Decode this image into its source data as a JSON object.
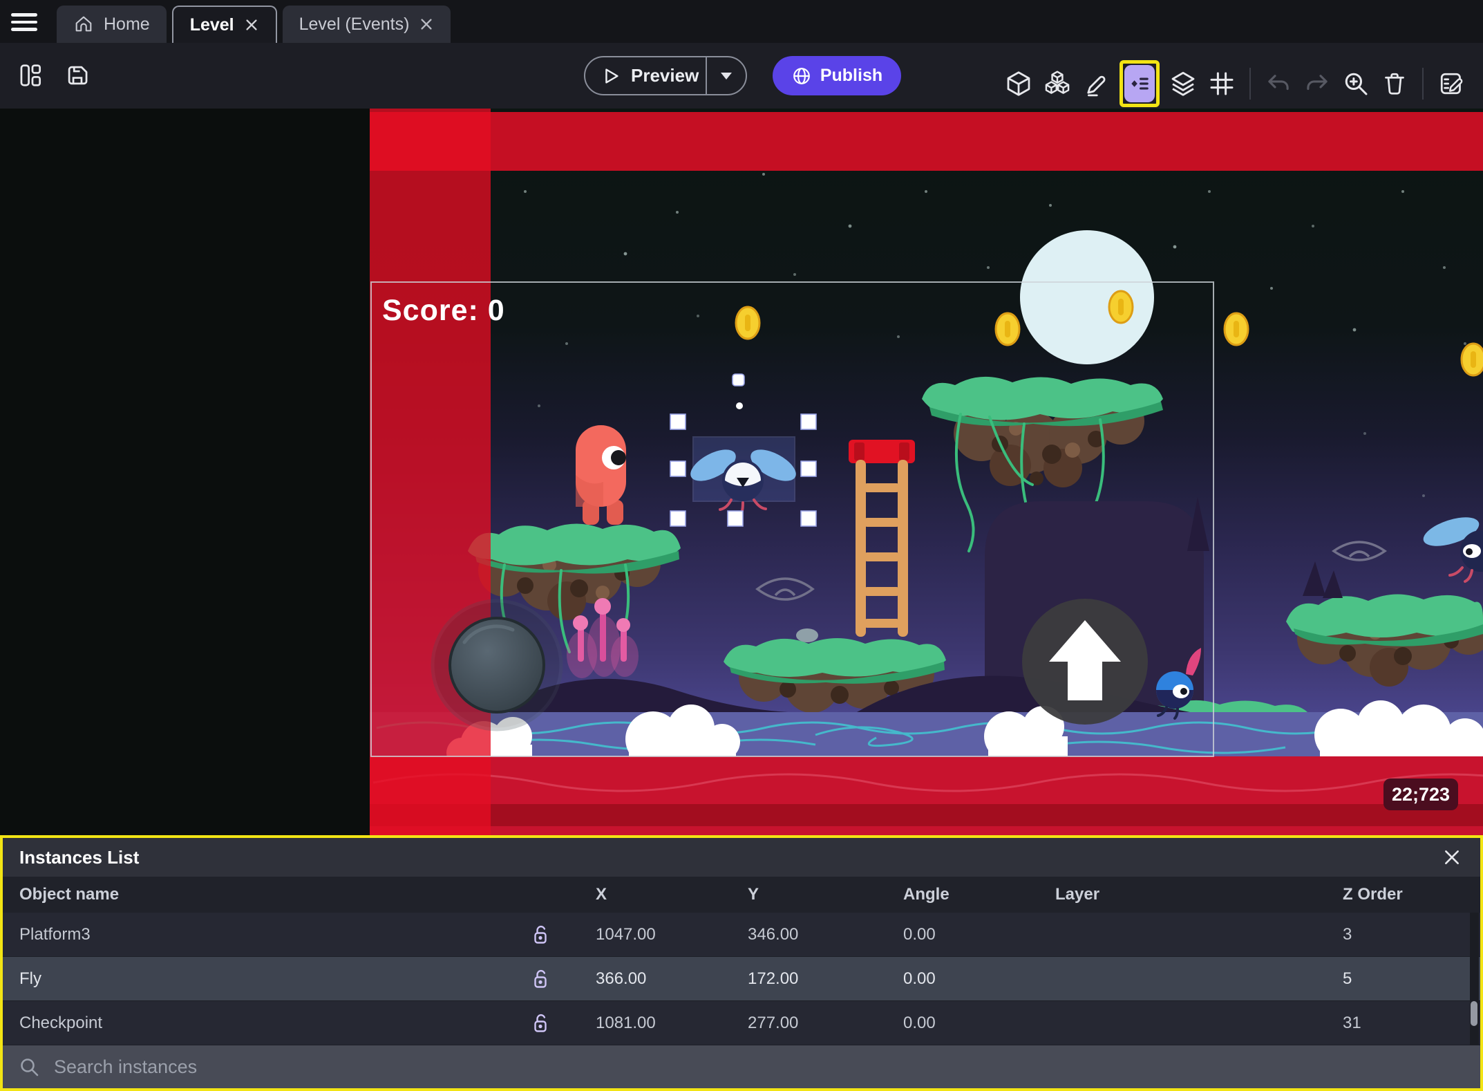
{
  "tabbar": {
    "tabs": [
      {
        "label": "Home",
        "closable": false
      },
      {
        "label": "Level",
        "closable": true,
        "active": true
      },
      {
        "label": "Level (Events)",
        "closable": true
      }
    ]
  },
  "toolbar": {
    "preview_label": "Preview",
    "publish_label": "Publish",
    "icons": [
      "project-manager-icon",
      "save-icon",
      "play-icon",
      "chevron-down-icon",
      "globe-icon",
      "objects-cube-icon",
      "object-groups-icon",
      "pencil-icon",
      "instances-list-icon",
      "layers-icon",
      "grid-icon",
      "undo-icon",
      "redo-icon",
      "zoom-in-icon",
      "trash-icon",
      "edit-scene-icon"
    ],
    "highlight_color": "#f2e414",
    "publish_color": "#5a43e8",
    "instances_button_active_bg": "#b7a6f3"
  },
  "canvas": {
    "score_text": "Score: 0",
    "coords_badge": "22;723",
    "scene_objects": [
      "player",
      "fly-enemy-selected",
      "coins",
      "platforms",
      "ladder",
      "moon",
      "joystick",
      "jump-button",
      "blue-enemy",
      "clouds"
    ]
  },
  "instances_panel": {
    "title": "Instances List",
    "columns": [
      "Object name",
      "X",
      "Y",
      "Angle",
      "Layer",
      "Z Order"
    ],
    "rows": [
      {
        "name": "Platform3",
        "x": "1047.00",
        "y": "346.00",
        "angle": "0.00",
        "layer": "",
        "z": "3",
        "selected": false
      },
      {
        "name": "Fly",
        "x": "366.00",
        "y": "172.00",
        "angle": "0.00",
        "layer": "",
        "z": "5",
        "selected": true
      },
      {
        "name": "Checkpoint",
        "x": "1081.00",
        "y": "277.00",
        "angle": "0.00",
        "layer": "",
        "z": "31",
        "selected": false
      }
    ],
    "search_placeholder": "Search instances",
    "border_color": "#f2e414"
  }
}
